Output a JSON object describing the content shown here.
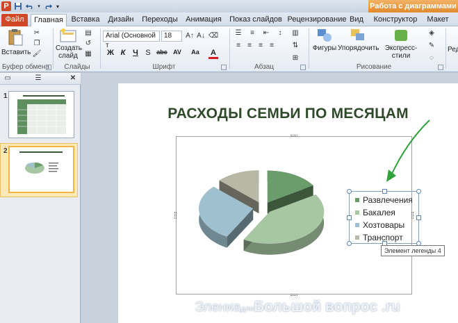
{
  "qat": {
    "app_icon": "P",
    "save_icon": "save-icon",
    "undo_icon": "undo-icon",
    "redo_icon": "redo-icon"
  },
  "context_header": "Работа с диаграммами",
  "tabs": [
    "Файл",
    "Главная",
    "Вставка",
    "Дизайн",
    "Переходы",
    "Анимация",
    "Показ слайдов",
    "Рецензирование",
    "Вид",
    "Конструктор",
    "Макет"
  ],
  "ribbon": {
    "paste": "Вставить",
    "create_slide_1": "Создать",
    "create_slide_2": "слайд",
    "font_name": "Arial (Основной т",
    "font_size": "18",
    "shapes": "Фигуры",
    "arrange": "Упорядочить",
    "quick_styles": "Экспресс-стили",
    "edit_cut": "Ред",
    "groups": {
      "clipboard": "Буфер обмена",
      "slides": "Слайды",
      "font": "Шрифт",
      "paragraph": "Абзац",
      "drawing": "Рисование"
    },
    "format_buttons": [
      "Ж",
      "К",
      "Ч",
      "S",
      "abc",
      "AV",
      "Aa",
      "A"
    ]
  },
  "panel": {
    "thumb1_num": "1",
    "thumb2_num": "2"
  },
  "slide": {
    "title": "РАСХОДЫ СЕМЬИ ПО МЕСЯЦАМ"
  },
  "chart_data": {
    "type": "pie",
    "exploded": true,
    "three_d": true,
    "categories": [
      "Развлечения",
      "Бакалея",
      "Хозтовары",
      "Транспорт"
    ],
    "values": [
      16,
      42,
      29,
      13
    ],
    "colors": [
      "#6b9c6b",
      "#a7c7a3",
      "#9fc1cf",
      "#b7b8a6"
    ],
    "legend_position": "right",
    "legend_selected": true
  },
  "tooltip": "Элемент легенды 4",
  "watermark": {
    "part1": "Элениа",
    "part2": "для",
    "part3": "Большой вопрос .ru"
  },
  "colors": {
    "accent_file_tab": "#d24726",
    "context_tab": "#e08b2c",
    "title_color": "#2f4a2a",
    "arrow": "#2ea33a"
  }
}
